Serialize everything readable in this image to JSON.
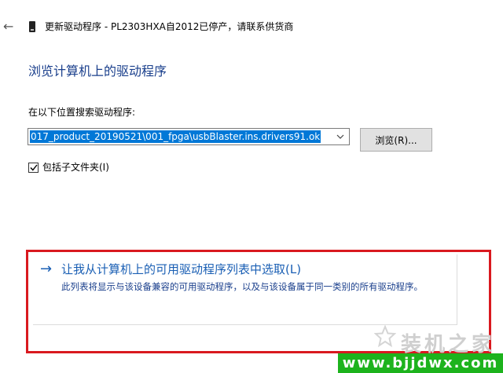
{
  "window": {
    "back_symbol": "←",
    "title": "更新驱动程序 - PL2303HXA自2012已停产，请联系供货商"
  },
  "page": {
    "heading": "浏览计算机上的驱动程序"
  },
  "search": {
    "label": "在以下位置搜索驱动程序:",
    "path_value": "017_product_20190521\\001_fpga\\usbBlaster.ins.drivers91.ok",
    "browse_label": "浏览(R)...",
    "include_subfolders_label": "包括子文件夹(I)",
    "include_subfolders_checked": true
  },
  "pick_option": {
    "arrow": "→",
    "title": "让我从计算机上的可用驱动程序列表中选取(L)",
    "description": "此列表将显示与该设备兼容的可用驱动程序，以及与该设备属于同一类别的所有驱动程序。"
  },
  "watermark": {
    "logo_text": "装机之家",
    "site_url": "www.bjjdwx.com"
  }
}
